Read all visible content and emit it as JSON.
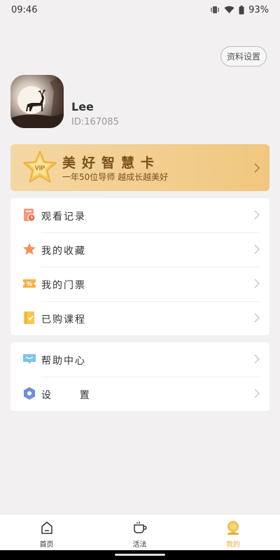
{
  "status_bar": {
    "time": "09:46",
    "battery": "93%"
  },
  "profile": {
    "settings_button": "资料设置",
    "name": "Lee",
    "id": "ID:167085"
  },
  "vip": {
    "badge": "VIP",
    "title": "美好智慧卡",
    "subtitle": "一年50位导师 越成长越美好"
  },
  "menu_group1": [
    {
      "label": "观看记录",
      "icon": "history-icon"
    },
    {
      "label": "我的收藏",
      "icon": "star-icon"
    },
    {
      "label": "我的门票",
      "icon": "ticket-icon"
    },
    {
      "label": "已购课程",
      "icon": "course-icon"
    }
  ],
  "menu_group2": [
    {
      "label": "帮助中心",
      "icon": "help-icon"
    },
    {
      "label": "设      置",
      "icon": "settings-icon"
    }
  ],
  "tabbar": [
    {
      "label": "首页",
      "icon": "home-icon",
      "active": false
    },
    {
      "label": "活法",
      "icon": "cup-icon",
      "active": false
    },
    {
      "label": "我的",
      "icon": "profile-icon",
      "active": true
    }
  ],
  "colors": {
    "accent": "#e3b03d",
    "vip_text": "#7b4f1c",
    "background": "#f2f0f1"
  }
}
